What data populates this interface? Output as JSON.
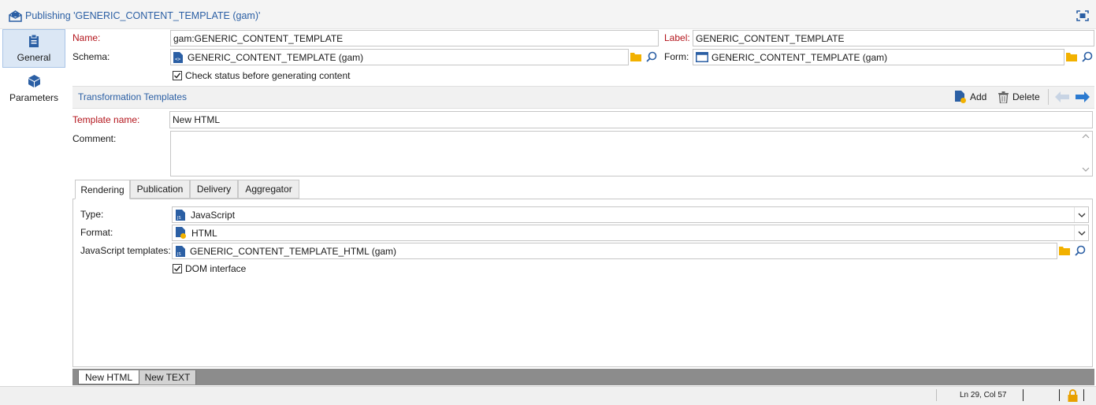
{
  "window": {
    "title": "Publishing 'GENERIC_CONTENT_TEMPLATE (gam)'"
  },
  "sidebar": {
    "items": [
      {
        "label": "General",
        "active": true
      },
      {
        "label": "Parameters",
        "active": false
      }
    ]
  },
  "form": {
    "name_label": "Name:",
    "name_value": "gam:GENERIC_CONTENT_TEMPLATE",
    "label_label": "Label:",
    "label_value": "GENERIC_CONTENT_TEMPLATE",
    "schema_label": "Schema:",
    "schema_value": "GENERIC_CONTENT_TEMPLATE (gam)",
    "form_label": "Form:",
    "form_value": "GENERIC_CONTENT_TEMPLATE (gam)",
    "check_status_label": "Check status before generating content",
    "check_status_checked": true
  },
  "transformation": {
    "section_title": "Transformation Templates",
    "add_label": "Add",
    "delete_label": "Delete",
    "template_name_label": "Template name:",
    "template_name_value": "New HTML",
    "comment_label": "Comment:",
    "comment_value": ""
  },
  "tabs": [
    {
      "label": "Rendering",
      "active": true
    },
    {
      "label": "Publication"
    },
    {
      "label": "Delivery"
    },
    {
      "label": "Aggregator"
    }
  ],
  "rendering": {
    "type_label": "Type:",
    "type_value": "JavaScript",
    "format_label": "Format:",
    "format_value": "HTML",
    "js_templates_label": "JavaScript templates:",
    "js_templates_value": "GENERIC_CONTENT_TEMPLATE_HTML (gam)",
    "dom_label": "DOM interface",
    "dom_checked": true
  },
  "bottom_tabs": [
    {
      "label": "New HTML",
      "active": true
    },
    {
      "label": "New TEXT"
    }
  ],
  "status": {
    "position": "Ln 29, Col 57"
  },
  "colors": {
    "accent": "#2b5fa4",
    "required": "#b3141b",
    "folder": "#f2b100",
    "lock": "#e8a000"
  }
}
